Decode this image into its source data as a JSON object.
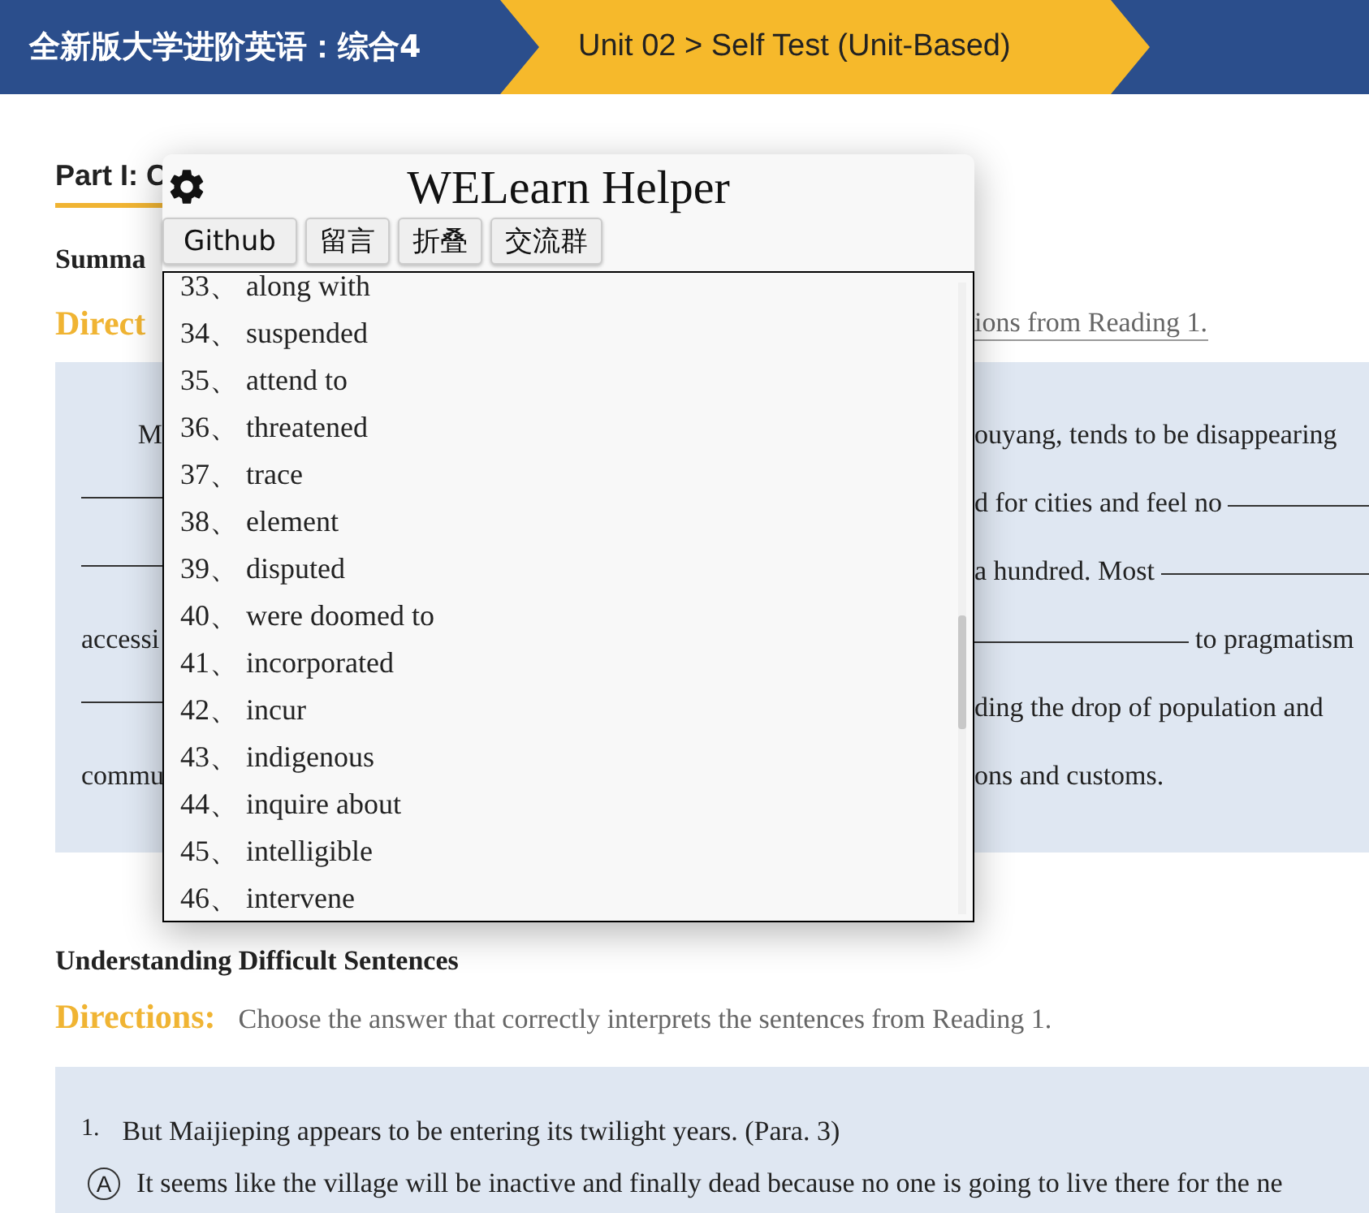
{
  "header": {
    "course": "全新版大学进阶英语：综合4",
    "breadcrumb": "Unit 02 > Self Test (Unit-Based)"
  },
  "part_heading": "Part I: C",
  "section_heading": "Summa",
  "directions": {
    "label": "Direct",
    "text": "ions from Reading 1."
  },
  "passage_lines": [
    {
      "left": [
        {
          "kind": "text",
          "text": "M"
        }
      ],
      "right": [
        {
          "kind": "text",
          "text": "ouyang, tends to be disappearing"
        }
      ]
    },
    {
      "left": [
        {
          "kind": "blank"
        }
      ],
      "right": [
        {
          "kind": "text",
          "text": "d for cities and feel no"
        },
        {
          "kind": "blank"
        }
      ]
    },
    {
      "left": [
        {
          "kind": "blank"
        }
      ],
      "right": [
        {
          "kind": "text",
          "text": "a hundred. Most"
        },
        {
          "kind": "blank"
        }
      ]
    },
    {
      "left": [
        {
          "kind": "text",
          "text": "accessi"
        }
      ],
      "right": [
        {
          "kind": "blank"
        },
        {
          "kind": "text",
          "text": "to pragmatism"
        }
      ]
    },
    {
      "left": [
        {
          "kind": "blank"
        }
      ],
      "right": [
        {
          "kind": "text",
          "text": "ding the drop of population and"
        }
      ]
    },
    {
      "left": [
        {
          "kind": "text",
          "text": "commu"
        }
      ],
      "right": [
        {
          "kind": "text",
          "text": "ons and customs."
        }
      ]
    }
  ],
  "helper": {
    "title": "WELearn Helper",
    "buttons": [
      "Github",
      "留言",
      "折叠",
      "交流群"
    ],
    "answers": [
      "33、 along with",
      "34、 suspended",
      "35、 attend to",
      "36、 threatened",
      "37、 trace",
      "38、 element",
      "39、 disputed",
      "40、 were doomed to",
      "41、 incorporated",
      "42、 incur",
      "43、 indigenous",
      "44、 inquire about",
      "45、 intelligible",
      "46、 intervene"
    ]
  },
  "sentences_section": {
    "heading": "Understanding Difficult Sentences",
    "directions_label": "Directions:",
    "directions_text": "Choose the answer that correctly interprets the sentences from Reading 1.",
    "question": {
      "number": "1.",
      "text": "But Maijieping appears to be entering its twilight years. (Para. 3)",
      "option_letter": "A",
      "option_text": "It seems like the village will be inactive and finally dead because no one is going to live there for the ne"
    }
  }
}
